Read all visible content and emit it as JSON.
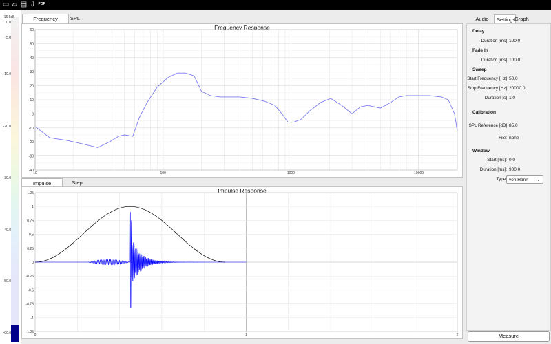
{
  "toolbar": {
    "icons": [
      "new-document-icon",
      "open-folder-icon",
      "save-icon",
      "export-icon",
      "pdf-icon"
    ],
    "pdf_label": "PDF"
  },
  "level_meter": {
    "labels": [
      "-16.6dB",
      "0.0",
      "-5.0",
      "-10.0",
      "-20.0",
      "-30.0",
      "-40.0",
      "-50.0",
      "-60.0"
    ],
    "fill_level": 0.05
  },
  "top_tabs": [
    {
      "label": "Frequency Response",
      "active": true
    },
    {
      "label": "SPL",
      "active": false
    }
  ],
  "bottom_tabs": [
    {
      "label": "Impulse Response",
      "active": true
    },
    {
      "label": "Step Response",
      "active": false
    }
  ],
  "right_tabs": [
    {
      "label": "Audio Device",
      "active": false
    },
    {
      "label": "Settings",
      "active": true
    },
    {
      "label": "Graph",
      "active": false
    }
  ],
  "settings": {
    "delay_title": "Delay",
    "delay_duration_label": "Duration [ms]",
    "delay_duration_value": "100.0",
    "fadein_title": "Fade In",
    "fadein_duration_label": "Duration [ms]",
    "fadein_duration_value": "100.0",
    "sweep_title": "Sweep",
    "start_freq_label": "Start Frequency [Hz]",
    "start_freq_value": "50.0",
    "stop_freq_label": "Stop Frequency [Hz]",
    "stop_freq_value": "20000.0",
    "sweep_duration_label": "Duration [s]",
    "sweep_duration_value": "1.0",
    "calibration_title": "Calibration",
    "spl_ref_label": "SPL Reference [dB]",
    "spl_ref_value": "85.0",
    "file_label": "File:",
    "file_value": "none",
    "window_title": "Window",
    "window_start_label": "Start [ms]:",
    "window_start_value": "0.0",
    "window_duration_label": "Duration [ms]:",
    "window_duration_value": "900.0",
    "type_label": "Type:",
    "type_value": "von Hann"
  },
  "measure_label": "Measure",
  "colors": {
    "fr_line": "#7b7bf0",
    "impulse": "#0000ff",
    "window": "#000000",
    "meter_fill": "#00008b"
  },
  "chart_data": [
    {
      "type": "line",
      "title": "Frequency Response",
      "xscale": "log",
      "xlim": [
        10,
        20000
      ],
      "ylim": [
        -40,
        60
      ],
      "x_tick_labels": [
        "10",
        "100",
        "1000",
        "10000"
      ],
      "y_ticks": [
        60,
        50,
        40,
        30,
        20,
        10,
        0,
        -10,
        -20,
        -30,
        -40
      ],
      "grid": true,
      "series": [
        {
          "x": [
            10,
            13,
            18,
            25,
            31,
            38,
            45,
            50,
            58,
            65,
            75,
            90,
            110,
            130,
            150,
            175,
            200,
            235,
            280,
            330,
            400,
            500,
            620,
            750,
            850,
            950,
            1050,
            1200,
            1400,
            1700,
            2050,
            2500,
            3000,
            3500,
            4000,
            4500,
            5000,
            6000,
            7000,
            8000,
            10000,
            12000,
            15000,
            17000,
            19000,
            20000
          ],
          "y": [
            -9,
            -17,
            -19,
            -22,
            -24,
            -20,
            -16,
            -15,
            -16,
            -3,
            8,
            19,
            26,
            29,
            29,
            27,
            16,
            13,
            12,
            12,
            12,
            11,
            9,
            6,
            0,
            -6,
            -6,
            -4,
            2,
            8,
            11,
            6,
            0,
            5,
            6,
            5,
            4,
            8,
            12,
            13,
            13,
            13,
            12,
            10,
            0,
            -12
          ]
        }
      ]
    },
    {
      "type": "line",
      "title": "Impulse Response",
      "xlim": [
        0,
        2
      ],
      "ylim": [
        -1.25,
        1.25
      ],
      "x_tick_labels": [
        "0",
        "1",
        "2"
      ],
      "y_ticks": [
        1.25,
        1,
        0.75,
        0.5,
        0.25,
        0,
        -0.25,
        -0.5,
        -0.75,
        -1,
        -1.25
      ],
      "grid": true,
      "series": [
        {
          "name": "",
          "kind": "window",
          "start": 0,
          "end": 0.9,
          "peak": 1.0
        },
        {
          "name": "",
          "kind": "impulse",
          "onset": 0.45,
          "peak": 0.9,
          "min": -0.82,
          "pre_ringing_from": 0.25,
          "decay_end": 0.7
        }
      ]
    }
  ]
}
